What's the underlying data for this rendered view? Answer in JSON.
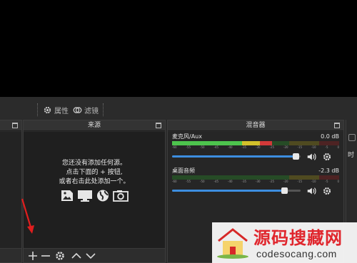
{
  "toolbar": {
    "properties_label": "属性",
    "filters_label": "滤镜"
  },
  "sources_dock": {
    "title": "来源",
    "empty_lines": [
      "您还没有添加任何源。",
      "点击下面的 + 按钮,",
      "或者右击此处添加一个。"
    ],
    "source_type_icons": [
      "image-icon",
      "display-capture-icon",
      "browser-icon",
      "camera-icon"
    ],
    "toolbar_icons": [
      "add-icon",
      "remove-icon",
      "gear-icon",
      "move-up-icon",
      "move-down-icon"
    ]
  },
  "mixer_dock": {
    "title": "混音器",
    "channels": [
      {
        "name": "麦克风/Aux",
        "db": "0.0 dB",
        "level": 0.6,
        "volume": 0.96
      },
      {
        "name": "桌面音频",
        "db": "-2.3 dB",
        "level": 0.0,
        "volume": 0.87
      }
    ],
    "tick_labels": [
      "-60",
      "-55",
      "-50",
      "-45",
      "-40",
      "-35",
      "-30",
      "-25",
      "-20",
      "-15",
      "-10",
      "-5",
      "0"
    ]
  },
  "right_dock": {
    "partial_label": "时"
  },
  "colors": {
    "accent": "#3d8ee0",
    "meter_green": "#4dc44d",
    "meter_yellow": "#d3c12b",
    "meter_red": "#d23939",
    "annotation_red": "#e01e1e"
  },
  "watermark": {
    "title": "源码搜藏网",
    "url": "codesocang.com"
  }
}
